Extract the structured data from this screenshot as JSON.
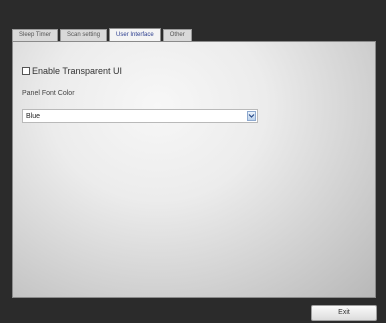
{
  "tabs": [
    {
      "label": "Sleep Timer",
      "active": false
    },
    {
      "label": "Scan setting",
      "active": false
    },
    {
      "label": "User Interface",
      "active": true
    },
    {
      "label": "Other",
      "active": false
    }
  ],
  "panel": {
    "transparent_checkbox": {
      "label": "Enable Transparent UI",
      "checked": false
    },
    "font_color": {
      "label": "Panel Font Color",
      "selected": "Blue"
    }
  },
  "footer": {
    "exit_label": "Exit"
  },
  "colors": {
    "active_tab_text": "#2c3e8f",
    "window_bg": "#2b2b2b",
    "dropdown_accent": "#bcd2ec"
  },
  "icons": {
    "dropdown": "chevron-down-icon"
  }
}
